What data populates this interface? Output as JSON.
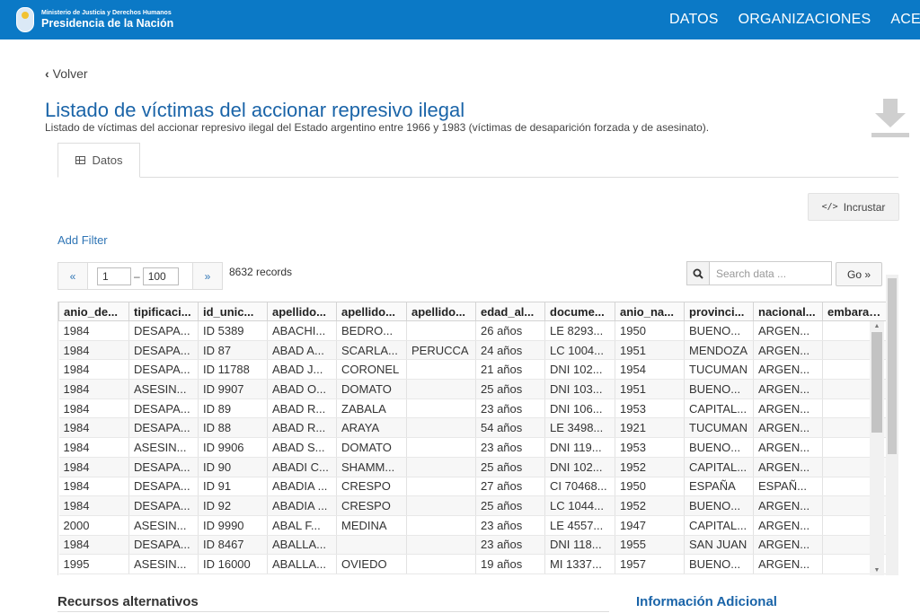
{
  "header": {
    "ministry": "Ministerio de Justicia y Derechos Humanos",
    "presidency": "Presidencia de la Nación",
    "nav": [
      "DATOS",
      "ORGANIZACIONES",
      "ACE"
    ],
    "bg_color": "#0b79c6"
  },
  "back_label": "Volver",
  "dataset": {
    "title": "Listado de víctimas del accionar represivo ilegal",
    "description": "Listado de víctimas del accionar represivo ilegal del Estado argentino entre 1966 y 1983 (víctimas de desaparición forzada y de asesinato)."
  },
  "tabs": [
    {
      "label": "Datos",
      "icon": "table-icon"
    }
  ],
  "embed_label": "Incrustar",
  "add_filter_label": "Add Filter",
  "pager": {
    "prev": "«",
    "next": "»",
    "from": "1",
    "separator": "–",
    "to": "100",
    "records": "8632 records"
  },
  "search": {
    "placeholder": "Search data ...",
    "go_label": "Go »"
  },
  "grid": {
    "columns": [
      "anio_de...",
      "tipificaci...",
      "id_unic...",
      "apellido...",
      "apellido...",
      "apellido...",
      "edad_al...",
      "docume...",
      "anio_na...",
      "provinci...",
      "nacional...",
      "embaraz..."
    ],
    "rows": [
      [
        "1984",
        "DESAPA...",
        "ID 5389",
        "ABACHI...",
        "BEDRO...",
        "",
        "26 años",
        "LE 8293...",
        "1950",
        "BUENO...",
        "ARGEN...",
        ""
      ],
      [
        "1984",
        "DESAPA...",
        "ID 87",
        "ABAD A...",
        "SCARLA...",
        "PERUCCA",
        "24 años",
        "LC 1004...",
        "1951",
        "MENDOZA",
        "ARGEN...",
        ""
      ],
      [
        "1984",
        "DESAPA...",
        "ID 11788",
        "ABAD J...",
        "CORONEL",
        "",
        "21 años",
        "DNI 102...",
        "1954",
        "TUCUMAN",
        "ARGEN...",
        ""
      ],
      [
        "1984",
        "ASESIN...",
        "ID 9907",
        "ABAD O...",
        "DOMATO",
        "",
        "25 años",
        "DNI 103...",
        "1951",
        "BUENO...",
        "ARGEN...",
        ""
      ],
      [
        "1984",
        "DESAPA...",
        "ID 89",
        "ABAD R...",
        "ZABALA",
        "",
        "23 años",
        "DNI 106...",
        "1953",
        "CAPITAL...",
        "ARGEN...",
        ""
      ],
      [
        "1984",
        "DESAPA...",
        "ID 88",
        "ABAD R...",
        "ARAYA",
        "",
        "54 años",
        "LE 3498...",
        "1921",
        "TUCUMAN",
        "ARGEN...",
        ""
      ],
      [
        "1984",
        "ASESIN...",
        "ID 9906",
        "ABAD S...",
        "DOMATO",
        "",
        "23 años",
        "DNI 119...",
        "1953",
        "BUENO...",
        "ARGEN...",
        ""
      ],
      [
        "1984",
        "DESAPA...",
        "ID 90",
        "ABADI C...",
        "SHAMM...",
        "",
        "25 años",
        "DNI 102...",
        "1952",
        "CAPITAL...",
        "ARGEN...",
        ""
      ],
      [
        "1984",
        "DESAPA...",
        "ID 91",
        "ABADIA ...",
        "CRESPO",
        "",
        "27 años",
        "CI 70468...",
        "1950",
        "ESPAÑA",
        "ESPAÑ...",
        ""
      ],
      [
        "1984",
        "DESAPA...",
        "ID 92",
        "ABADIA ...",
        "CRESPO",
        "",
        "25 años",
        "LC 1044...",
        "1952",
        "BUENO...",
        "ARGEN...",
        ""
      ],
      [
        "2000",
        "ASESIN...",
        "ID 9990",
        "ABAL F...",
        "MEDINA",
        "",
        "23 años",
        "LE 4557...",
        "1947",
        "CAPITAL...",
        "ARGEN...",
        ""
      ],
      [
        "1984",
        "DESAPA...",
        "ID 8467",
        "ABALLA...",
        "",
        "",
        "23 años",
        "DNI 118...",
        "1955",
        "SAN JUAN",
        "ARGEN...",
        ""
      ],
      [
        "1995",
        "ASESIN...",
        "ID 16000",
        "ABALLA...",
        "OVIEDO",
        "",
        "19 años",
        "MI 1337...",
        "1957",
        "BUENO...",
        "ARGEN...",
        ""
      ]
    ]
  },
  "footer": {
    "alt_resources": "Recursos alternativos",
    "additional_info": "Información Adicional"
  }
}
